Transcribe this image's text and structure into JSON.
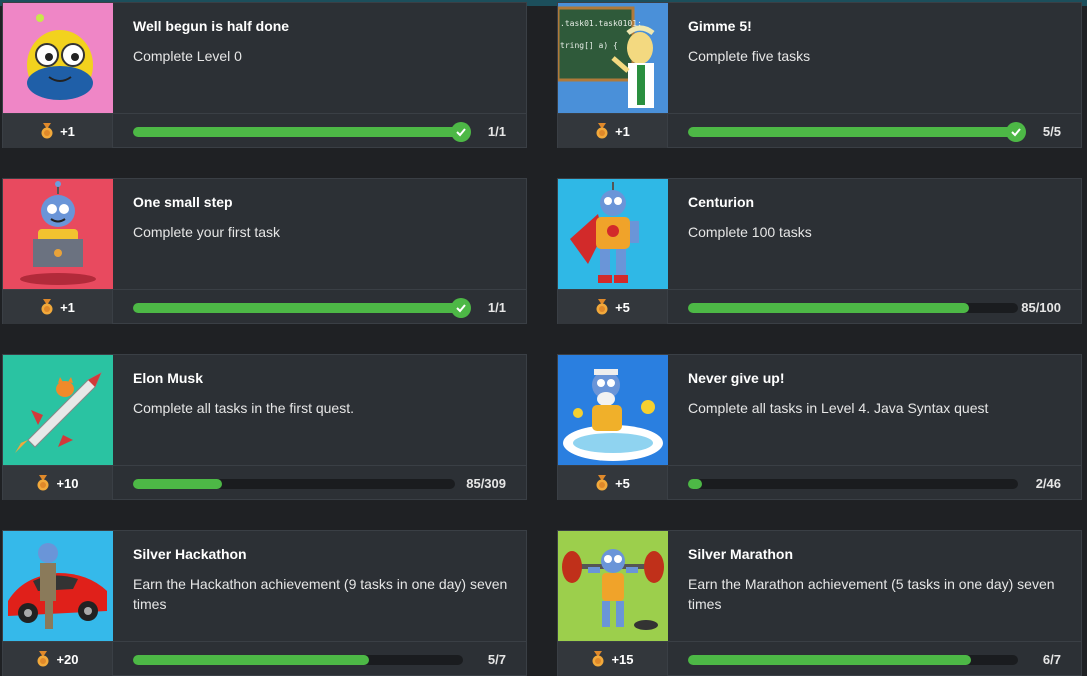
{
  "colors": {
    "progress": "#4db846",
    "card_bg": "#2c3035",
    "page_bg": "#1f2124"
  },
  "cards": [
    {
      "title": "Well begun is half done",
      "desc": "Complete Level 0",
      "reward": "+1",
      "count": "1/1",
      "progress": 1.0,
      "complete": true,
      "thumb_bg": "#ef86c6",
      "thumb_icon": "goggle-robot-icon"
    },
    {
      "title": "Gimme 5!",
      "desc": "Complete five tasks",
      "reward": "+1",
      "count": "5/5",
      "progress": 1.0,
      "complete": true,
      "thumb_bg": "#4a90d9",
      "thumb_icon": "professor-chalkboard-icon",
      "thumb_text_1": ".task01.task0101;",
      "thumb_text_2": "tring[] a) {"
    },
    {
      "title": "One small step",
      "desc": "Complete your first task",
      "reward": "+1",
      "count": "1/1",
      "progress": 1.0,
      "complete": true,
      "thumb_bg": "#e84a5f",
      "thumb_icon": "robot-laptop-icon"
    },
    {
      "title": "Centurion",
      "desc": "Complete 100 tasks",
      "reward": "+5",
      "count": "85/100",
      "progress": 0.85,
      "complete": false,
      "thumb_bg": "#2fb8e6",
      "thumb_icon": "superhero-robot-icon"
    },
    {
      "title": "Elon Musk",
      "desc": "Complete all tasks in the first quest.",
      "reward": "+10",
      "count": "85/309",
      "progress": 0.275,
      "complete": false,
      "thumb_bg": "#2ac3a2",
      "thumb_icon": "cat-rocket-icon"
    },
    {
      "title": "Never give up!",
      "desc": "Complete all tasks in Level 4. Java Syntax quest",
      "reward": "+5",
      "count": "2/46",
      "progress": 0.043,
      "complete": false,
      "thumb_bg": "#2a7fe0",
      "thumb_icon": "robot-bath-icon"
    },
    {
      "title": "Silver Hackathon",
      "desc": "Earn the Hackathon achievement (9 tasks in one day) seven times",
      "reward": "+20",
      "count": "5/7",
      "progress": 0.714,
      "complete": false,
      "thumb_bg": "#35b9ea",
      "thumb_icon": "robot-sports-car-icon"
    },
    {
      "title": "Silver Marathon",
      "desc": "Earn the Marathon achievement (5 tasks in one day) seven times",
      "reward": "+15",
      "count": "6/7",
      "progress": 0.857,
      "complete": false,
      "thumb_bg": "#9ccf4c",
      "thumb_icon": "robot-weightlift-icon"
    }
  ]
}
